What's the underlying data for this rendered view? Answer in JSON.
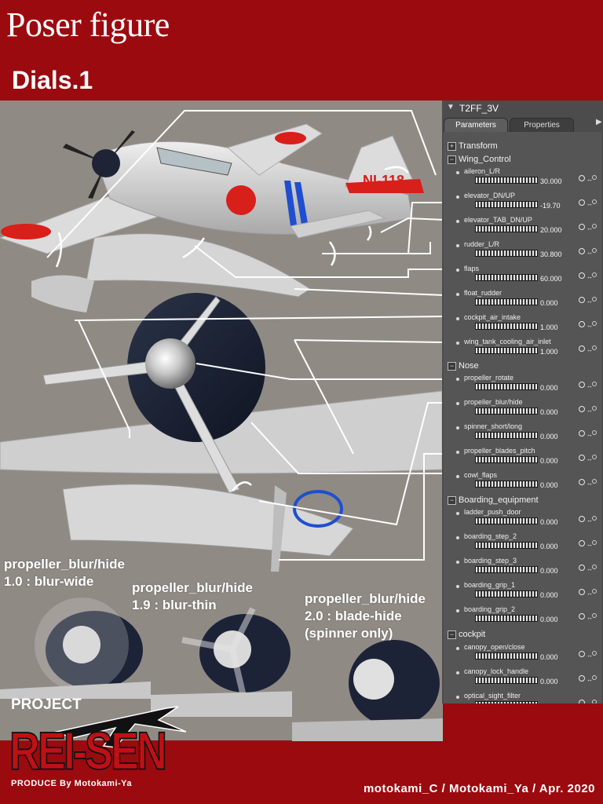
{
  "title": "Poser figure",
  "subtitle": "Dials.1",
  "panel": {
    "figure_name": "T2FF_3V",
    "tabs": [
      "Parameters",
      "Properties"
    ],
    "groups": [
      {
        "label": "Transform",
        "expanded": false
      },
      {
        "label": "Wing_Control",
        "expanded": true
      },
      {
        "label": "Nose",
        "expanded": true
      },
      {
        "label": "Boarding_equipment",
        "expanded": true
      },
      {
        "label": "cockpit",
        "expanded": true
      }
    ],
    "wing_control_params": [
      {
        "name": "aileron_L/R",
        "value": "30.000"
      },
      {
        "name": "elevator_DN/UP",
        "value": "-19.70"
      },
      {
        "name": "elevator_TAB_DN/UP",
        "value": "20.000"
      },
      {
        "name": "rudder_L/R",
        "value": "30.800"
      },
      {
        "name": "flaps",
        "value": "60.000"
      },
      {
        "name": "float_rudder",
        "value": "0.000"
      },
      {
        "name": "cockpit_air_intake",
        "value": "1.000"
      },
      {
        "name": "wing_tank_cooling_air_inlet",
        "value": "1.000"
      }
    ],
    "nose_params": [
      {
        "name": "propeller_rotate",
        "value": "0.000"
      },
      {
        "name": "propeller_blur/hide",
        "value": "0.000"
      },
      {
        "name": "spinner_short/long",
        "value": "0.000"
      },
      {
        "name": "propeller_blades_pitch",
        "value": "0.000"
      },
      {
        "name": "cowl_flaps",
        "value": "0.000"
      }
    ],
    "boarding_params": [
      {
        "name": "ladder_push_door",
        "value": "0.000"
      },
      {
        "name": "boarding_step_2",
        "value": "0.000"
      },
      {
        "name": "boarding_step_3",
        "value": "0.000"
      },
      {
        "name": "boarding_grip_1",
        "value": "0.000"
      },
      {
        "name": "boarding_grip_2",
        "value": "0.000"
      }
    ],
    "cockpit_params": [
      {
        "name": "canopy_open/close",
        "value": "0.000"
      },
      {
        "name": "canopy_lock_handle",
        "value": "0.000"
      },
      {
        "name": "optical_sight_filter",
        "value": ""
      }
    ]
  },
  "insets": [
    {
      "line1": "propeller_blur/hide",
      "line2": "1.0 : blur-wide",
      "line3": ""
    },
    {
      "line1": "propeller_blur/hide",
      "line2": "1.9 : blur-thin",
      "line3": ""
    },
    {
      "line1": "propeller_blur/hide",
      "line2": "2.0 : blade-hide",
      "line3": "(spinner only)"
    }
  ],
  "aircraft_marking": "NI-118",
  "logo": {
    "project": "PROJECT",
    "reisen": "REI-SEN",
    "produce": "PRODUCE By Motokami-Ya"
  },
  "credit": "motokami_C / Motokami_Ya / Apr. 2020",
  "colors": {
    "page_background": "#9b0a0f",
    "render_background": "#908a85",
    "panel_background": "#4c4c4c",
    "hinomaru_red": "#d81f1a",
    "band_blue": "#1f4fcf"
  }
}
